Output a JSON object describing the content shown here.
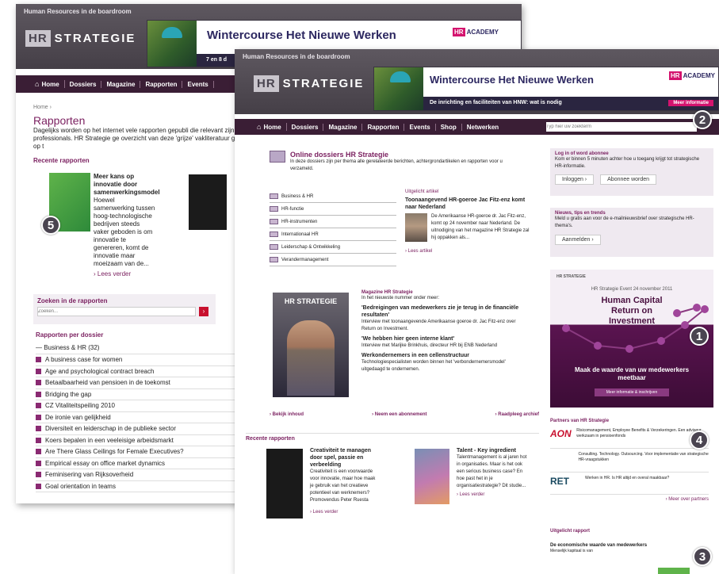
{
  "back": {
    "tagline": "Human Resources in de boardroom",
    "logo_hr": "HR",
    "logo_strategie": "STRATEGIE",
    "banner_title": "Wintercourse Het Nieuwe Werken",
    "banner_strip": "7 en 8 d",
    "academy_hr": "HR",
    "academy_word": "ACADEMY",
    "nav": [
      "Home",
      "Dossiers",
      "Magazine",
      "Rapporten",
      "Events"
    ],
    "breadcrumb": "Home ›",
    "page_title": "Rapporten",
    "intro": "Dagelijks worden op het internet vele rapporten gepubli die relevant zijn voor HR-professionals. HR Strategie ge overzicht van deze 'grijze' vakliteratuur gesorteerd op t",
    "recent_heading": "Recente rapporten",
    "report_title": "Meer kans op innovatie door samenwerkingsmodel",
    "report_text": "Hoewel samenwerking tussen hoog-technologische bedrijven steeds vaker geboden is om innovatie te genereren, komt de innovatie maar moeizaam van de...",
    "read_more": "› Lees verder",
    "search_heading": "Zoeken in de rapporten",
    "search_placeholder": "Zoeken...",
    "per_dossier": "Rapporten per dossier",
    "dossier": "— Business & HR (32)",
    "items": [
      "A business case for women",
      "Age and psychological contract breach",
      "Betaalbaarheid van pensioen in de toekomst",
      "Bridging the gap",
      "CZ Vitaliteitspeiling 2010",
      "De ironie van gelijkheid",
      "Diversiteit en leiderschap in de publieke sector",
      "Koers bepalen in een veeleisige arbeidsmarkt",
      "Are There Glass Ceilings for Female Executives?",
      "Empirical essay on office market dynamics",
      "Feminisering van Rijksoverheid",
      "Goal orientation in teams"
    ],
    "badge": "5"
  },
  "front": {
    "tagline": "Human Resources in de boardroom",
    "logo_hr": "HR",
    "logo_strategie": "STRATEGIE",
    "banner_title": "Wintercourse Het Nieuwe Werken",
    "banner_strip": "De inrichting en faciliteiten van HNW: wat is nodig",
    "banner_btn": "Meer informatie",
    "academy_hr": "HR",
    "academy_word": "ACADEMY",
    "nav": [
      "Home",
      "Dossiers",
      "Magazine",
      "Rapporten",
      "Events",
      "Shop",
      "Netwerken"
    ],
    "search_placeholder": "Typ hier uw zoekterm",
    "dossiers_title": "Online dossiers HR Strategie",
    "dossiers_text": "In deze dossiers zijn per thema alle gerelateerde berichten, achtergrondartikelen en rapporten voor u verzameld.",
    "dossier_list": [
      "Business & HR",
      "HR-functie",
      "HR-instrumenten",
      "Internationaal HR",
      "Leiderschap & Ontwikkeling",
      "Verandermanagement"
    ],
    "featured_label": "Uitgelicht artikel",
    "featured_title": "Toonaangevend HR-goeroe Jac Fitz-enz komt naar Nederland",
    "featured_text": "De Amerikaanse HR-goeroe dr. Jac Fitz-enz, komt op 24 november naar Nederland. De uitnodiging van het magazine HR Strategie zal hij oppakken als...",
    "featured_more": "› Lees artikel",
    "magazine_label": "Magazine HR Strategie",
    "magazine_intro": "In het nieuwste nummer onder meer:",
    "mag_items": [
      {
        "title": "'Bedreigingen van medewerkers zie je terug in de financiële resultaten'",
        "text": "Interview met toonaangevende Amerikaanse goeroe dr. Jac Fitz-enz over Return on Investment."
      },
      {
        "title": "'We hebben hier geen interne klant'",
        "text": "Interview met Marijke Brinkhuis, directeur HR bij ENB Nederland"
      },
      {
        "title": "Werkondernemers in een cellenstructuur",
        "text": "Technologiespecialisten worden binnen het 'verbondernemersmodel' uitgedaagd te ondernemen."
      }
    ],
    "mag_links": [
      "› Bekijk inhoud",
      "› Neem een abonnement",
      "› Raadpleeg archief"
    ],
    "recent_heading": "Recente rapporten",
    "rep1_title": "Creativiteit te managen door spel, passie en verbeelding",
    "rep1_text": "Creativiteit is een voorwaarde voor innovatie, maar hoe maak je gebruik van het creatieve potentieel van werknemers?",
    "rep1_source": "Promovendus Peter Ruesta",
    "rep1_more": "› Lees verder",
    "rep2_title": "Talent - Key ingredient",
    "rep2_text": "Talentmanagement is al jaren hot in organisaties. Maar is het ook een serious business case? En hoe past het in je organisatiestrategie? Dit studie...",
    "rep2_more": "› Lees verder",
    "login_title": "Log in of word abonnee",
    "login_text": "Kom er binnen 5 minuten achter hoe u toegang krijgt tot strategische HR-informatie.",
    "login_btn": "Inloggen",
    "subscribe_btn": "Abonnee worden",
    "news_title": "Nieuws, tips en trends",
    "news_text": "Meld u gratis aan voor de e-mailnieuwsbrief over strategische HR-thema's.",
    "signup_btn": "Aanmelden",
    "ad_brand": "HR STRATEGIE",
    "ad_date": "HR Strategie Event 24 november 2011",
    "ad_title": "Human Capital Return on Investment",
    "ad_tagline": "Maak de waarde van uw medewerkers meetbaar",
    "ad_btn": "Meer informatie & inschrijven",
    "partners_title": "Partners van HR Strategie",
    "partners": [
      {
        "logo": "AON",
        "text": "Risicomanagement, Employee Benefits & Verzekeringen. Een adviseur werkzaam in pensioenfonds"
      },
      {
        "logo": "",
        "text": "Consulting. Technology. Outsourcing. Voor implementatie van strategische HR-vraagstukken"
      },
      {
        "logo": "RET",
        "text": "Werken in HR. Is HR altijd en overal maakbaar?"
      }
    ],
    "partners_more": "› Meer over partners",
    "featured_report_label": "Uitgelicht rapport",
    "featured_report_title": "De economische waarde van medewerkers",
    "featured_report_text": "Menselijk kapitaal is van",
    "badges": [
      "2",
      "1",
      "4",
      "3"
    ]
  }
}
